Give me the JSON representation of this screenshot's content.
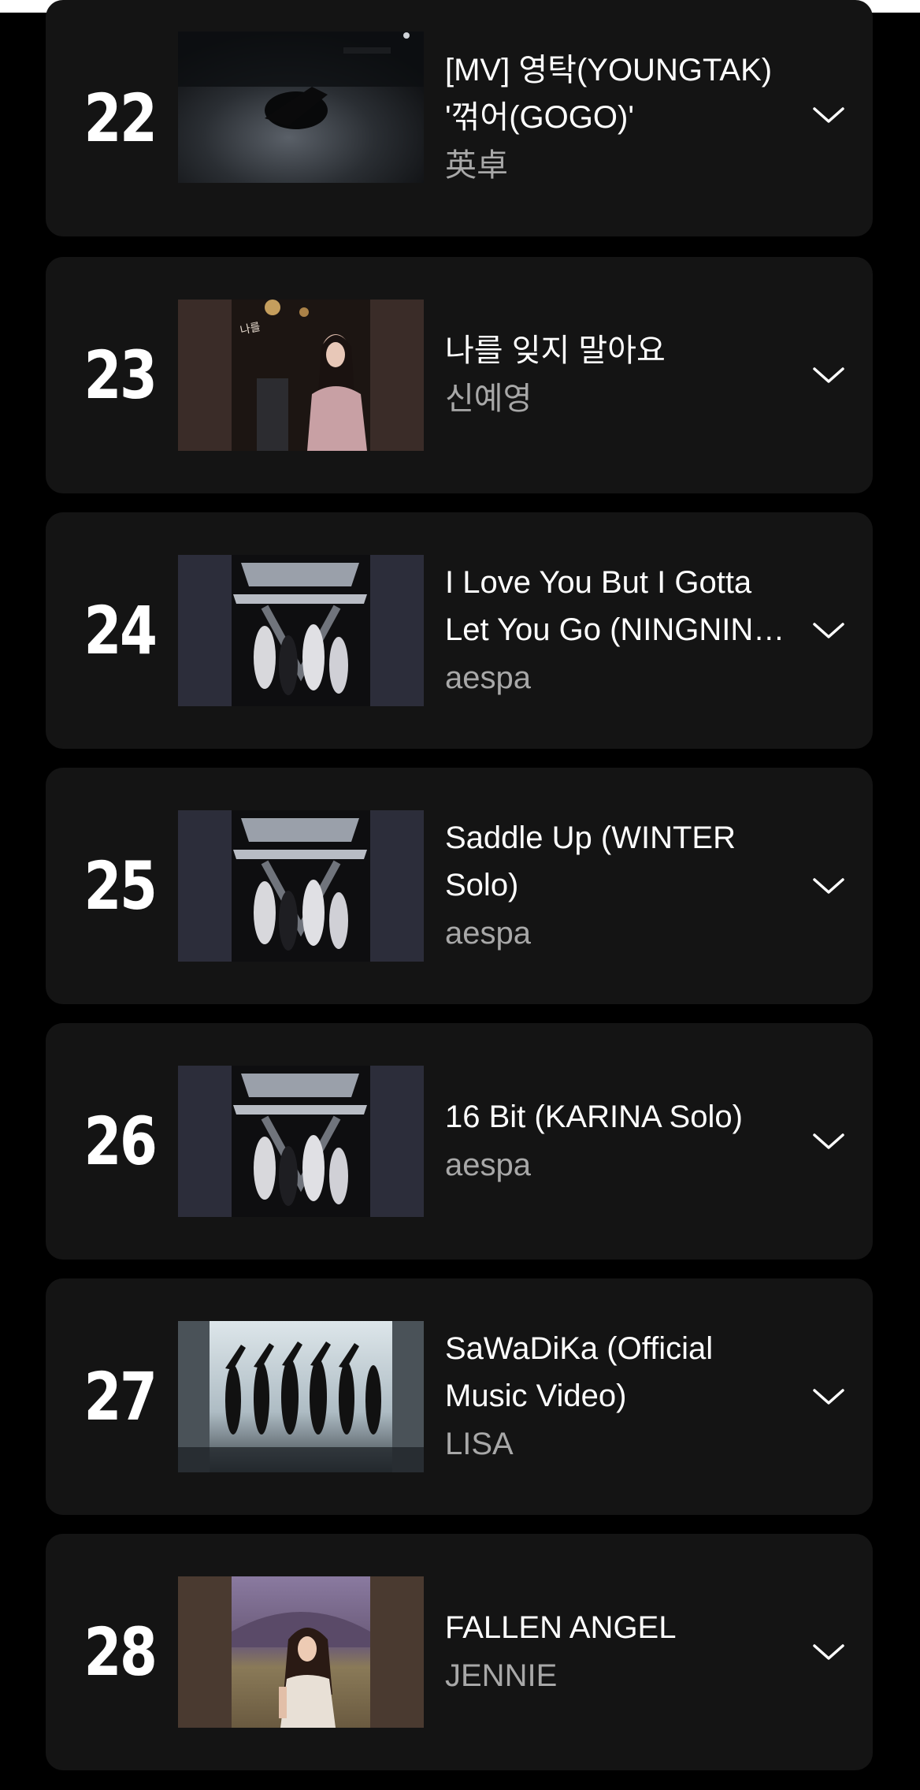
{
  "chart": {
    "entries": [
      {
        "rank": "22",
        "title": "[MV] 영탁(YOUNGTAK) '꺾어(GOGO)'",
        "artist": "英卓",
        "thumb": "dark-scene",
        "expand_icon": "chevron-down-icon"
      },
      {
        "rank": "23",
        "title": "나를 잊지 말아요",
        "artist": "신예영",
        "thumb": "portrait-cafe",
        "expand_icon": "chevron-down-icon"
      },
      {
        "rank": "24",
        "title": "I Love You But I Gotta Let You Go (NINGNING Solo)",
        "artist": "aespa",
        "thumb": "aespa-complexity",
        "expand_icon": "chevron-down-icon"
      },
      {
        "rank": "25",
        "title": "Saddle Up (WINTER Solo)",
        "artist": "aespa",
        "thumb": "aespa-complexity",
        "expand_icon": "chevron-down-icon"
      },
      {
        "rank": "26",
        "title": "16 Bit (KARINA Solo)",
        "artist": "aespa",
        "thumb": "aespa-complexity",
        "expand_icon": "chevron-down-icon"
      },
      {
        "rank": "27",
        "title": "SaWaDiKa (Official Music Video)",
        "artist": "LISA",
        "thumb": "dancers-silhouette",
        "expand_icon": "chevron-down-icon"
      },
      {
        "rank": "28",
        "title": "FALLEN ANGEL",
        "artist": "JENNIE",
        "thumb": "portrait-field",
        "expand_icon": "chevron-down-icon"
      }
    ]
  },
  "colors": {
    "background": "#000000",
    "card": "#141414",
    "title": "#ffffff",
    "artist": "#a8a8a8"
  }
}
